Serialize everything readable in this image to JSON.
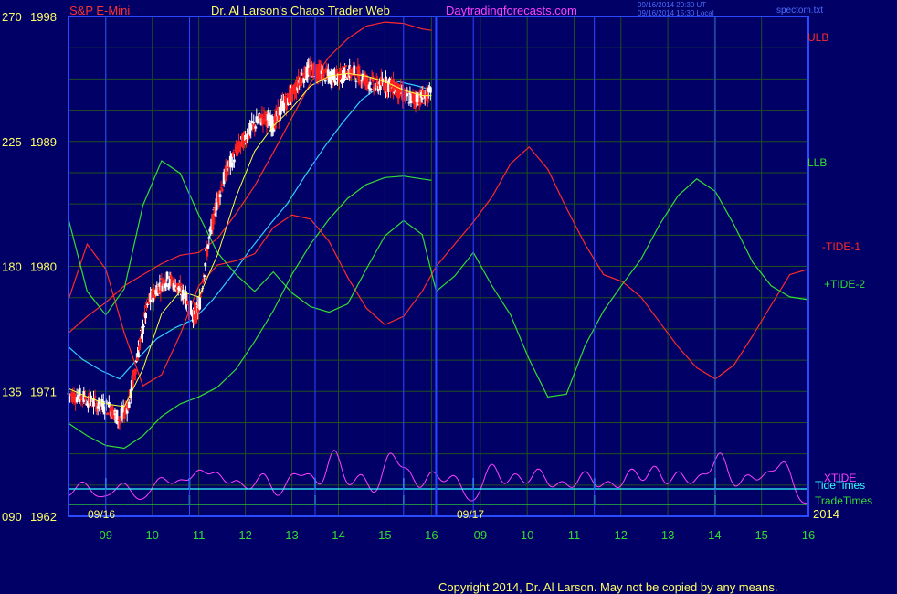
{
  "header": {
    "symbol": "S&P E-Mini",
    "brand": "Dr. Al Larson's Chaos Trader Web",
    "site": "Daytradingforecasts.com",
    "stamp_line1": "09/16/2014 20:30 UT",
    "stamp_line2": "09/16/2014 15:30 Local",
    "filename": "spectom.txt"
  },
  "footer": {
    "copyright": "Copyright 2014, Dr. Al Larson. May not be copied by any means."
  },
  "chart_data": {
    "type": "line",
    "title": "",
    "y_left_ticks": [
      {
        "deg": "270",
        "price": "1998"
      },
      {
        "deg": "225",
        "price": "1989"
      },
      {
        "deg": "180",
        "price": "1980"
      },
      {
        "deg": "135",
        "price": "1971"
      },
      {
        "deg": "090",
        "price": "1962"
      }
    ],
    "ylim_price": [
      1962,
      1998
    ],
    "x_ticks": [
      "09",
      "10",
      "11",
      "12",
      "13",
      "14",
      "15",
      "16",
      "09",
      "10",
      "11",
      "12",
      "13",
      "14",
      "15",
      "16"
    ],
    "date_labels": [
      "09/16",
      "09/17"
    ],
    "year_label": "2014",
    "xlim_hours": [
      8.2,
      24.1
    ],
    "day_break_hour": 16.1,
    "series_labels": {
      "ulb": "ULB",
      "llb": "LLB",
      "tide1": "-TIDE-1",
      "tide2": "+TIDE-2",
      "xtide": "XTIDE",
      "tidetimes": "TideTimes",
      "tradetimes": "TradeTimes"
    },
    "colors": {
      "background": "#000066",
      "grid": "#1f4f1f",
      "axis": "#2a4aff",
      "tick_text": "#ffff66",
      "header_red": "#ff3030",
      "header_yellow": "#ffff66",
      "site_magenta": "#ff40ff",
      "stamp_blue": "#4a6cff",
      "ulb": "#ff2a2a",
      "llb": "#33dd33",
      "mid": "#33ccff",
      "tide1": "#ff2a2a",
      "tide2": "#33dd33",
      "xtide": "#ff40ff",
      "tidetimes": "#33ffff",
      "tradetimes": "#33dd33",
      "candle_up": "#ffffff",
      "candle_down": "#ff2020",
      "ma_fast": "#ffff44",
      "copyright": "#ffff66"
    },
    "price_path": [
      [
        8.2,
        1970.8
      ],
      [
        8.5,
        1970.6
      ],
      [
        8.8,
        1970.1
      ],
      [
        9.1,
        1969.8
      ],
      [
        9.3,
        1968.9
      ],
      [
        9.5,
        1970.2
      ],
      [
        9.7,
        1973.9
      ],
      [
        9.9,
        1977.2
      ],
      [
        10.1,
        1978.4
      ],
      [
        10.3,
        1979.1
      ],
      [
        10.5,
        1978.7
      ],
      [
        10.7,
        1977.8
      ],
      [
        10.9,
        1976.4
      ],
      [
        11.0,
        1977.0
      ],
      [
        11.2,
        1981.6
      ],
      [
        11.4,
        1984.8
      ],
      [
        11.6,
        1986.9
      ],
      [
        11.8,
        1988.2
      ],
      [
        12.0,
        1989.3
      ],
      [
        12.2,
        1990.2
      ],
      [
        12.4,
        1990.8
      ],
      [
        12.6,
        1990.2
      ],
      [
        12.8,
        1991.6
      ],
      [
        13.0,
        1992.3
      ],
      [
        13.2,
        1993.6
      ],
      [
        13.4,
        1994.2
      ],
      [
        13.6,
        1994.0
      ],
      [
        13.8,
        1993.6
      ],
      [
        14.0,
        1993.7
      ],
      [
        14.2,
        1994.0
      ],
      [
        14.4,
        1993.9
      ],
      [
        14.6,
        1993.4
      ],
      [
        14.8,
        1993.0
      ],
      [
        15.0,
        1993.2
      ],
      [
        15.2,
        1992.9
      ],
      [
        15.4,
        1992.3
      ],
      [
        15.6,
        1992.1
      ],
      [
        15.8,
        1992.2
      ],
      [
        16.0,
        1992.4
      ]
    ],
    "ma_fast": [
      [
        8.2,
        1971.2
      ],
      [
        8.6,
        1970.6
      ],
      [
        9.0,
        1970.1
      ],
      [
        9.4,
        1969.9
      ],
      [
        9.8,
        1972.6
      ],
      [
        10.2,
        1976.6
      ],
      [
        10.6,
        1978.2
      ],
      [
        11.0,
        1977.8
      ],
      [
        11.4,
        1980.8
      ],
      [
        11.8,
        1985.0
      ],
      [
        12.2,
        1988.3
      ],
      [
        12.6,
        1990.1
      ],
      [
        13.0,
        1991.4
      ],
      [
        13.4,
        1993.0
      ],
      [
        13.8,
        1993.7
      ],
      [
        14.2,
        1993.9
      ],
      [
        14.6,
        1993.7
      ],
      [
        15.0,
        1993.3
      ],
      [
        15.4,
        1992.7
      ],
      [
        15.8,
        1992.3
      ],
      [
        16.0,
        1992.3
      ]
    ],
    "mid_band": [
      [
        8.2,
        1974.2
      ],
      [
        8.5,
        1973.3
      ],
      [
        8.9,
        1972.5
      ],
      [
        9.3,
        1971.9
      ],
      [
        9.7,
        1973.4
      ],
      [
        10.1,
        1974.8
      ],
      [
        10.5,
        1975.6
      ],
      [
        10.9,
        1976.2
      ],
      [
        11.3,
        1977.6
      ],
      [
        11.7,
        1979.3
      ],
      [
        12.1,
        1981.2
      ],
      [
        12.5,
        1982.9
      ],
      [
        12.9,
        1984.5
      ],
      [
        13.3,
        1986.6
      ],
      [
        13.7,
        1988.6
      ],
      [
        14.1,
        1990.4
      ],
      [
        14.5,
        1992.0
      ],
      [
        14.9,
        1993.0
      ],
      [
        15.3,
        1993.3
      ],
      [
        15.7,
        1993.0
      ],
      [
        16.0,
        1992.7
      ]
    ],
    "ulb": [
      [
        8.2,
        1975.2
      ],
      [
        8.6,
        1976.4
      ],
      [
        9.0,
        1977.4
      ],
      [
        9.4,
        1978.6
      ],
      [
        9.8,
        1979.4
      ],
      [
        10.2,
        1980.2
      ],
      [
        10.6,
        1980.8
      ],
      [
        11.0,
        1981.0
      ],
      [
        11.4,
        1982.0
      ],
      [
        11.8,
        1983.8
      ],
      [
        12.2,
        1985.8
      ],
      [
        12.6,
        1988.2
      ],
      [
        13.0,
        1990.7
      ],
      [
        13.4,
        1993.2
      ],
      [
        13.8,
        1995.1
      ],
      [
        14.2,
        1996.4
      ],
      [
        14.6,
        1997.3
      ],
      [
        15.0,
        1997.6
      ],
      [
        15.4,
        1997.5
      ],
      [
        15.8,
        1997.1
      ],
      [
        16.0,
        1997.0
      ]
    ],
    "llb": [
      [
        8.2,
        1968.7
      ],
      [
        8.6,
        1967.8
      ],
      [
        9.0,
        1967.1
      ],
      [
        9.4,
        1966.9
      ],
      [
        9.8,
        1967.8
      ],
      [
        10.2,
        1969.2
      ],
      [
        10.6,
        1970.1
      ],
      [
        11.0,
        1970.6
      ],
      [
        11.4,
        1971.3
      ],
      [
        11.8,
        1972.6
      ],
      [
        12.2,
        1974.6
      ],
      [
        12.6,
        1976.8
      ],
      [
        13.0,
        1979.4
      ],
      [
        13.4,
        1981.6
      ],
      [
        13.8,
        1983.4
      ],
      [
        14.2,
        1984.9
      ],
      [
        14.6,
        1985.9
      ],
      [
        15.0,
        1986.4
      ],
      [
        15.4,
        1986.5
      ],
      [
        15.8,
        1986.3
      ],
      [
        16.0,
        1986.2
      ]
    ],
    "tide1": [
      [
        8.2,
        1977.6
      ],
      [
        8.6,
        1981.6
      ],
      [
        9.0,
        1979.8
      ],
      [
        9.4,
        1975.2
      ],
      [
        9.8,
        1971.4
      ],
      [
        10.2,
        1972.2
      ],
      [
        10.6,
        1975.1
      ],
      [
        11.0,
        1978.6
      ],
      [
        11.4,
        1980.1
      ],
      [
        11.8,
        1980.4
      ],
      [
        12.2,
        1980.9
      ],
      [
        12.6,
        1982.8
      ],
      [
        13.0,
        1983.7
      ],
      [
        13.4,
        1983.4
      ],
      [
        13.8,
        1981.8
      ],
      [
        14.2,
        1979.2
      ],
      [
        14.6,
        1977.0
      ],
      [
        15.0,
        1975.8
      ],
      [
        15.4,
        1976.4
      ],
      [
        15.8,
        1978.2
      ],
      [
        16.1,
        1980.0
      ],
      [
        16.5,
        1981.6
      ],
      [
        16.9,
        1983.2
      ],
      [
        17.3,
        1985.0
      ],
      [
        17.7,
        1987.4
      ],
      [
        18.1,
        1988.6
      ],
      [
        18.5,
        1987.0
      ],
      [
        18.9,
        1984.2
      ],
      [
        19.3,
        1981.6
      ],
      [
        19.7,
        1979.4
      ],
      [
        20.1,
        1978.9
      ],
      [
        20.5,
        1977.8
      ],
      [
        20.9,
        1976.0
      ],
      [
        21.3,
        1974.2
      ],
      [
        21.7,
        1972.7
      ],
      [
        22.1,
        1971.9
      ],
      [
        22.5,
        1972.9
      ],
      [
        22.9,
        1975.0
      ],
      [
        23.3,
        1977.2
      ],
      [
        23.7,
        1979.4
      ],
      [
        24.1,
        1979.8
      ]
    ],
    "tide2": [
      [
        8.2,
        1983.4
      ],
      [
        8.6,
        1978.2
      ],
      [
        9.0,
        1976.5
      ],
      [
        9.4,
        1978.4
      ],
      [
        9.8,
        1984.4
      ],
      [
        10.2,
        1987.6
      ],
      [
        10.6,
        1986.7
      ],
      [
        11.0,
        1983.7
      ],
      [
        11.4,
        1981.0
      ],
      [
        11.8,
        1979.4
      ],
      [
        12.2,
        1978.2
      ],
      [
        12.6,
        1979.6
      ],
      [
        13.0,
        1978.1
      ],
      [
        13.4,
        1977.1
      ],
      [
        13.8,
        1976.7
      ],
      [
        14.2,
        1977.3
      ],
      [
        14.6,
        1979.8
      ],
      [
        15.0,
        1982.2
      ],
      [
        15.4,
        1983.3
      ],
      [
        15.8,
        1982.3
      ],
      [
        16.1,
        1978.2
      ],
      [
        16.5,
        1979.3
      ],
      [
        16.9,
        1981.0
      ],
      [
        17.3,
        1978.6
      ],
      [
        17.7,
        1976.5
      ],
      [
        18.1,
        1973.3
      ],
      [
        18.5,
        1970.6
      ],
      [
        18.9,
        1970.8
      ],
      [
        19.3,
        1974.3
      ],
      [
        19.7,
        1976.8
      ],
      [
        20.1,
        1978.7
      ],
      [
        20.5,
        1980.5
      ],
      [
        20.9,
        1983.0
      ],
      [
        21.3,
        1985.1
      ],
      [
        21.7,
        1986.3
      ],
      [
        22.1,
        1985.4
      ],
      [
        22.5,
        1983.0
      ],
      [
        22.9,
        1980.3
      ],
      [
        23.3,
        1978.6
      ],
      [
        23.7,
        1977.8
      ],
      [
        24.1,
        1977.6
      ]
    ],
    "xtide_peaks": [
      8.5,
      9.4,
      10.2,
      10.6,
      11.0,
      11.4,
      11.8,
      12.4,
      13.0,
      13.4,
      13.9,
      14.5,
      15.1,
      15.5,
      16.0,
      16.5,
      17.3,
      17.8,
      18.3,
      18.8,
      19.3,
      19.8,
      20.3,
      20.8,
      21.3,
      21.8,
      22.2,
      22.8,
      23.2,
      23.6
    ],
    "xtide_heights": [
      0.45,
      0.4,
      0.4,
      0.45,
      0.5,
      0.55,
      0.4,
      0.55,
      0.45,
      0.5,
      1.0,
      0.55,
      0.85,
      0.6,
      0.55,
      0.5,
      0.65,
      0.6,
      0.55,
      0.45,
      0.5,
      0.45,
      0.55,
      0.75,
      0.5,
      0.55,
      0.9,
      0.55,
      0.5,
      0.7
    ],
    "tidetimes_marks": [
      9.0,
      10.8,
      13.5,
      15.4,
      16.1,
      16.9,
      19.5,
      22.1
    ],
    "tradetimes_marks": [
      10.8,
      13.5,
      15.4,
      19.5,
      22.1
    ]
  }
}
